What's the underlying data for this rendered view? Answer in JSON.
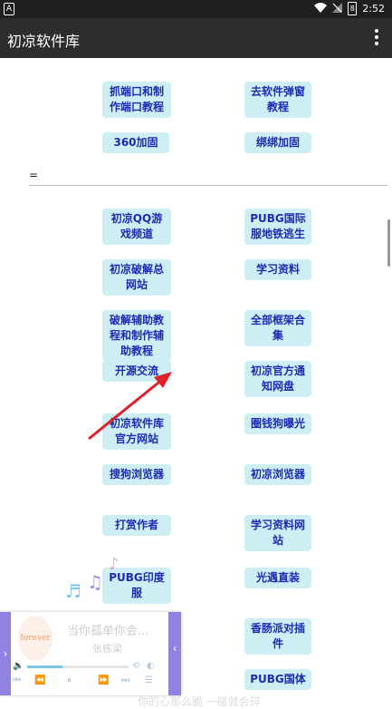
{
  "status": {
    "notification_icon": "A",
    "time": "2:52",
    "battery": "8"
  },
  "app": {
    "title": "初凉软件库"
  },
  "separator_label": "=",
  "top_buttons": [
    "抓端口和制作端口教程",
    "去软件弹窗教程",
    "360加固",
    "绑绑加固"
  ],
  "left_buttons": [
    "初凉QQ游戏频道",
    "初凉破解总网站",
    "破解辅助教程和制作辅助教程",
    "开源交流",
    "初凉软件库官方网站",
    "搜狗浏览器",
    "打赏作者",
    "PUBG印度服"
  ],
  "right_buttons": [
    "PUBG国际服地铁逃生",
    "学习资料",
    "全部框架合集",
    "初凉官方通知网盘",
    "圈钱狗曝光",
    "初凉浏览器",
    "学习资料网站",
    "光遇直装",
    "香肠派对插件",
    "PUBG国体"
  ],
  "player": {
    "song": "当你孤单你会...",
    "artist": "张栋梁",
    "cover_text": "forever",
    "progress": 0.35
  },
  "lyric": "你的心那么脆 一碰就会碎",
  "colors": {
    "button_bg": "#cdeff3",
    "button_text": "#1d2bb3",
    "appbar": "#2d2d2d",
    "annotation_arrow": "#e0202a",
    "player_tab": "#8f82e0"
  }
}
